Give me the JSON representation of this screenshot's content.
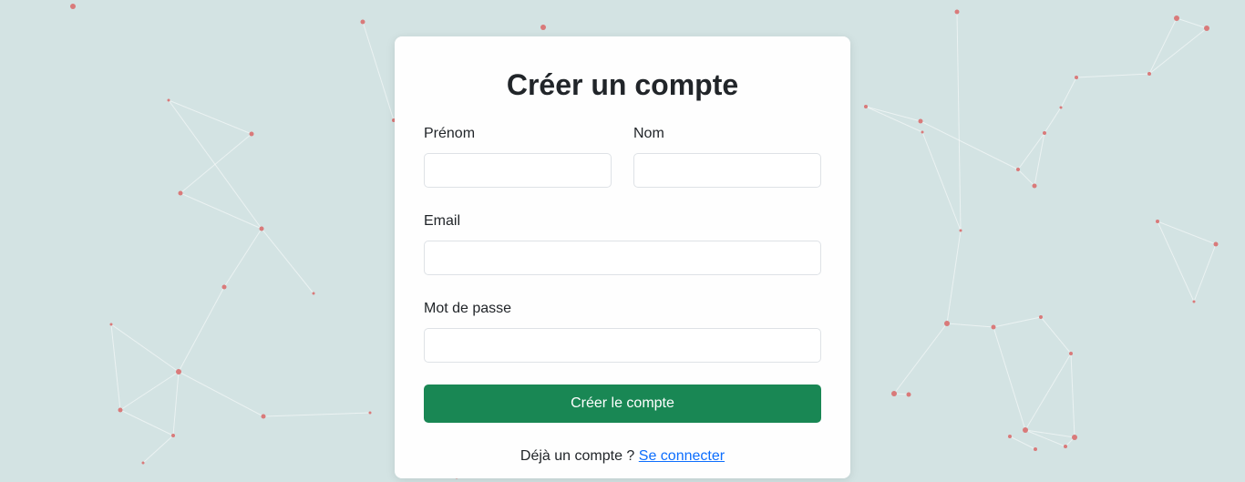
{
  "form": {
    "title": "Créer un compte",
    "first_name": {
      "label": "Prénom",
      "value": "",
      "placeholder": ""
    },
    "last_name": {
      "label": "Nom",
      "value": "",
      "placeholder": ""
    },
    "email": {
      "label": "Email",
      "value": "",
      "placeholder": ""
    },
    "password": {
      "label": "Mot de passe",
      "value": "",
      "placeholder": ""
    },
    "submit_label": "Créer le compte",
    "footer_text": "Déjà un compte ?",
    "login_link": "Se connecter"
  },
  "colors": {
    "background": "#d3e3e3",
    "accent": "#198754",
    "link": "#0d6efd",
    "node": "#d97a7a",
    "edge": "#ffffff"
  }
}
